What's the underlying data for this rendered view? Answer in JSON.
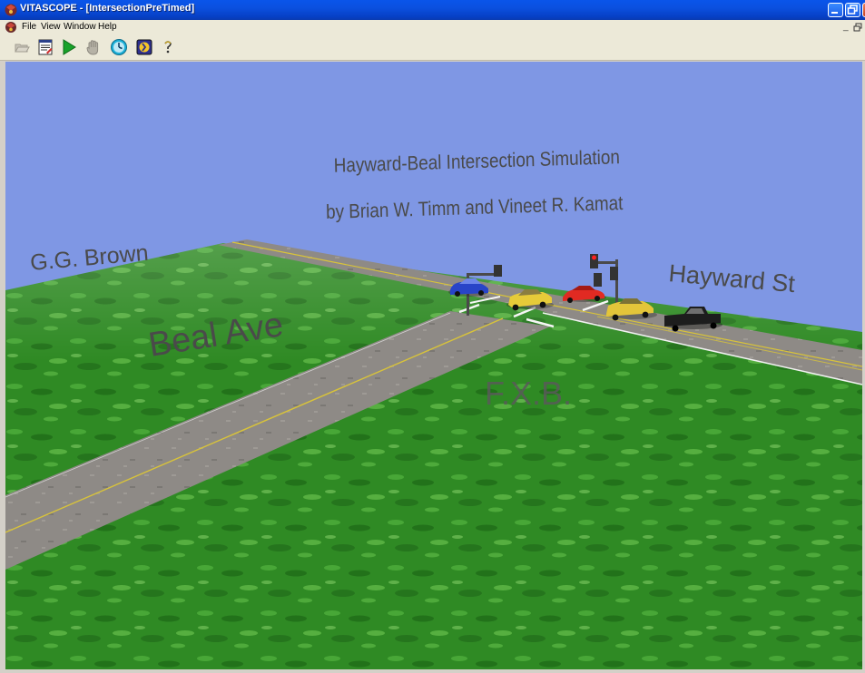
{
  "window": {
    "title": "VITASCOPE - [IntersectionPreTimed]",
    "controls": [
      "minimize",
      "maximize",
      "close"
    ]
  },
  "menu": {
    "items": [
      "File",
      "View",
      "Window",
      "Help"
    ],
    "mdi_controls": [
      "_",
      "ฅ"
    ]
  },
  "toolbar": {
    "buttons": [
      {
        "name": "open-icon",
        "enabled": false
      },
      {
        "name": "script-editor-icon",
        "enabled": true
      },
      {
        "name": "play-icon",
        "enabled": true
      },
      {
        "name": "hand-icon",
        "enabled": false
      },
      {
        "name": "clock-icon",
        "enabled": true
      },
      {
        "name": "speed-icon",
        "enabled": true
      },
      {
        "name": "help-icon",
        "enabled": true
      }
    ]
  },
  "scene": {
    "title_line1": "Hayward-Beal Intersection Simulation",
    "title_line2": "by Brian W. Timm and Vineet R. Kamat",
    "labels": {
      "gg_brown": "G.G. Brown",
      "beal_ave": "Beal Ave",
      "fxb": "F.X.B.",
      "hayward_st": "Hayward St"
    },
    "colors": {
      "sky": "#7f97e4",
      "grass": "#2f8a24",
      "road": "#8e8a86",
      "center_line": "#d8c33a",
      "label_text": "#4a4a4a"
    }
  }
}
